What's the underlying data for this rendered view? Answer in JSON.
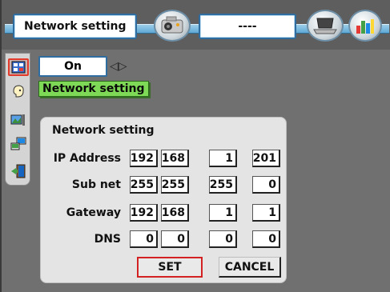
{
  "header": {
    "title": "Network setting",
    "value": "----",
    "icons": [
      "projector-icon",
      "laptop-icon",
      "chart-icon"
    ]
  },
  "side_menu": {
    "items": [
      "network-icon",
      "face-icon",
      "image-icon",
      "computer-icon",
      "exit-door-icon"
    ]
  },
  "control": {
    "state": "On",
    "arrows": "◁▷",
    "tooltip": "Network setting"
  },
  "dialog": {
    "title": "Network setting",
    "rows": [
      {
        "label": "IP Address",
        "octets": [
          "192",
          "168",
          "1",
          "201"
        ]
      },
      {
        "label": "Sub net",
        "octets": [
          "255",
          "255",
          "255",
          "0"
        ]
      },
      {
        "label": "Gateway",
        "octets": [
          "192",
          "168",
          "1",
          "1"
        ]
      },
      {
        "label": "DNS",
        "octets": [
          "0",
          "0",
          "0",
          "0"
        ]
      }
    ],
    "set_label": "SET",
    "cancel_label": "CANCEL"
  },
  "colors": {
    "accent_blue": "#2f6da0",
    "tooltip_green": "#7ed957",
    "selection_red": "#d32222"
  }
}
